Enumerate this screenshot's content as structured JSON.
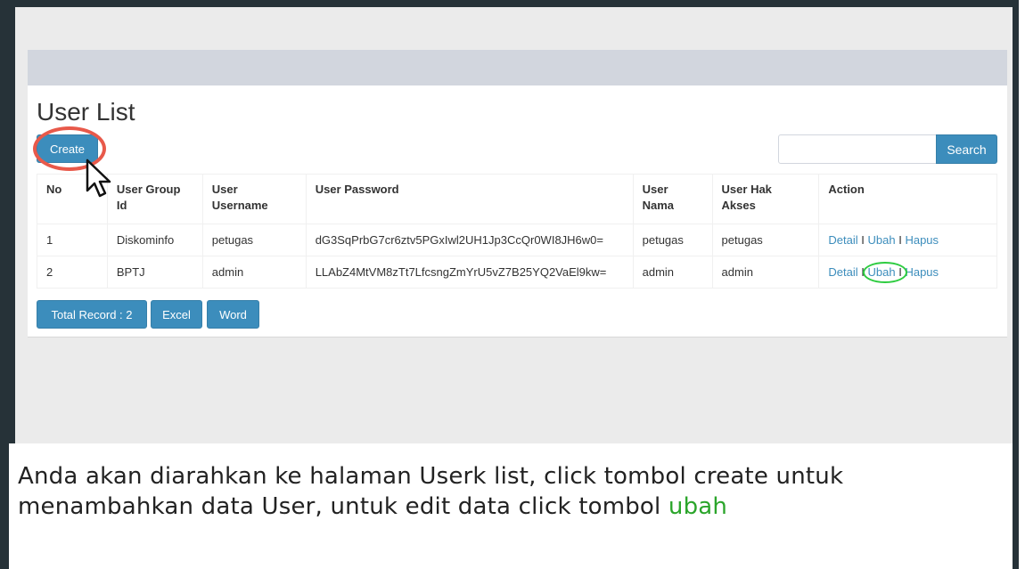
{
  "page": {
    "title": "User List"
  },
  "toolbar": {
    "create_label": "Create",
    "search_placeholder": "",
    "search_value": "",
    "search_label": "Search"
  },
  "table": {
    "headers": {
      "no": "No",
      "group_line1": "User Group",
      "group_line2": "Id",
      "username_line1": "User",
      "username_line2": "Username",
      "password": "User Password",
      "nama_line1": "User",
      "nama_line2": "Nama",
      "hak_line1": "User Hak",
      "hak_line2": "Akses",
      "action": "Action"
    },
    "rows": [
      {
        "no": "1",
        "group": "Diskominfo",
        "username": "petugas",
        "password": "dG3SqPrbG7cr6ztv5PGxIwl2UH1Jp3CcQr0WI8JH6w0=",
        "nama": "petugas",
        "hak": "petugas"
      },
      {
        "no": "2",
        "group": "BPTJ",
        "username": "admin",
        "password": "LLAbZ4MtVM8zTt7LfcsngZmYrU5vZ7B25YQ2VaEl9kw=",
        "nama": "admin",
        "hak": "admin"
      }
    ],
    "actions": {
      "detail": "Detail",
      "ubah": "Ubah",
      "hapus": "Hapus",
      "separator": "I"
    }
  },
  "footer_buttons": {
    "total": "Total Record : 2",
    "excel": "Excel",
    "word": "Word"
  },
  "caption": {
    "text": "Anda akan diarahkan ke halaman Userk list, click tombol create untuk menambahkan data User, untuk edit data click tombol ",
    "highlight": "ubah"
  },
  "colors": {
    "primary": "#3c8dbc",
    "highlight_ring_create": "#e8594a",
    "highlight_ring_ubah": "#2ecc40",
    "caption_highlight": "#2ba52b"
  }
}
